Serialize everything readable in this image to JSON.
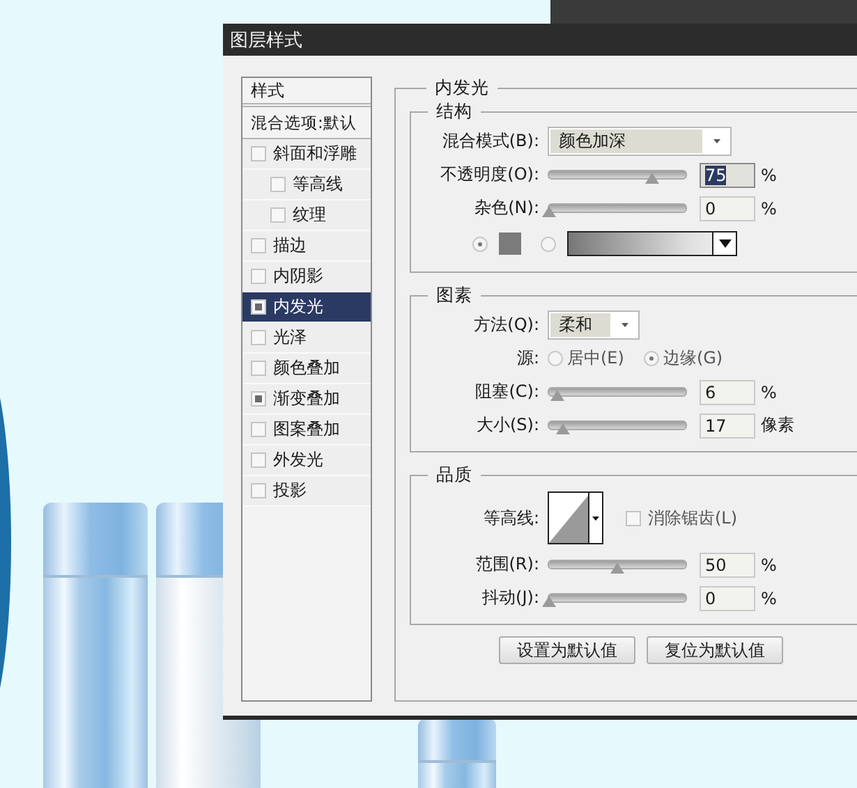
{
  "dialog": {
    "title": "图层样式"
  },
  "sidebar": {
    "header": "样式",
    "blending_options": "混合选项:默认",
    "items": [
      {
        "label": "斜面和浮雕",
        "checked": false,
        "selected": false,
        "children": [
          {
            "label": "等高线",
            "checked": false,
            "selected": false
          },
          {
            "label": "纹理",
            "checked": false,
            "selected": false
          }
        ]
      },
      {
        "label": "描边",
        "checked": false,
        "selected": false
      },
      {
        "label": "内阴影",
        "checked": false,
        "selected": false
      },
      {
        "label": "内发光",
        "checked": true,
        "selected": true
      },
      {
        "label": "光泽",
        "checked": false,
        "selected": false
      },
      {
        "label": "颜色叠加",
        "checked": false,
        "selected": false
      },
      {
        "label": "渐变叠加",
        "checked": true,
        "selected": false
      },
      {
        "label": "图案叠加",
        "checked": false,
        "selected": false
      },
      {
        "label": "外发光",
        "checked": false,
        "selected": false
      },
      {
        "label": "投影",
        "checked": false,
        "selected": false
      }
    ]
  },
  "panel": {
    "title": "内发光",
    "structure": {
      "title": "结构",
      "blend_mode": {
        "label": "混合模式(B):",
        "value": "颜色加深"
      },
      "opacity": {
        "label": "不透明度(O):",
        "level": 0.75,
        "value": "75",
        "unit": "%",
        "focused": true
      },
      "noise": {
        "label": "杂色(N):",
        "level": 0,
        "value": "0",
        "unit": "%",
        "focused": false
      },
      "fill_options": [
        {
          "kind": "color",
          "selected": true
        },
        {
          "kind": "gradient",
          "selected": false
        }
      ]
    },
    "elements": {
      "title": "图素",
      "technique": {
        "label": "方法(Q):",
        "value": "柔和"
      },
      "source": {
        "label": "源:",
        "options": [
          {
            "label": "居中(E)",
            "selected": false
          },
          {
            "label": "边缘(G)",
            "selected": true
          }
        ]
      },
      "choke": {
        "label": "阻塞(C):",
        "level": 0.06,
        "value": "6",
        "unit": "%",
        "focused": false
      },
      "size": {
        "label": "大小(S):",
        "level": 0.1,
        "value": "17",
        "unit": "像素",
        "focused": false
      }
    },
    "quality": {
      "title": "品质",
      "contour": {
        "label": "等高线:"
      },
      "anti_aliased": {
        "label": "消除锯齿(L)",
        "checked": false
      },
      "range": {
        "label": "范围(R):",
        "level": 0.5,
        "value": "50",
        "unit": "%",
        "focused": false
      },
      "jitter": {
        "label": "抖动(J):",
        "level": 0,
        "value": "0",
        "unit": "%",
        "focused": false
      }
    },
    "buttons": [
      "设置为默认值",
      "复位为默认值"
    ]
  }
}
